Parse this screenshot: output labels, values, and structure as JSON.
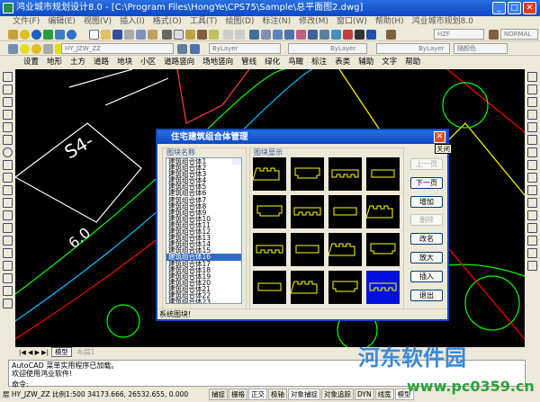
{
  "window": {
    "title": "鸿业城市规划设计8.0 - [C:\\Program Files\\HongYe\\CPS75\\Sample\\总平面图2.dwg]",
    "min": "_",
    "max": "□",
    "close": "✕"
  },
  "menu": [
    "文件(F)",
    "编辑(E)",
    "视图(V)",
    "插入(I)",
    "格式(O)",
    "工具(T)",
    "绘图(D)",
    "标注(N)",
    "修改(M)",
    "窗口(W)",
    "帮助(H)",
    "鸿业城市规划8.0"
  ],
  "toolbar": {
    "layer": "HY_JZW_ZZ",
    "textstyle": "HZF",
    "dimstyle": "NORMAL",
    "color": "ByLayer",
    "linetype": "ByLayer",
    "lineweight": "ByLayer",
    "plotstyle": "随颜色"
  },
  "custom_menu": [
    "设置",
    "地形",
    "土方",
    "道路",
    "地块",
    "小区",
    "道路竖向",
    "场地竖向",
    "管线",
    "绿化",
    "鸟瞰",
    "标注",
    "表类",
    "辅助",
    "文字",
    "帮助"
  ],
  "drawing": {
    "label1": "S4-",
    "label2": "6.0"
  },
  "dialog": {
    "title": "住宅建筑组合体管理",
    "close_tooltip": "关闭",
    "list_label": "图块名称",
    "preview_label": "图块显示",
    "items": [
      "建筑组合体1",
      "建筑组合体2",
      "建筑组合体3",
      "建筑组合体4",
      "建筑组合体5",
      "建筑组合体6",
      "建筑组合体7",
      "建筑组合体8",
      "建筑组合体9",
      "建筑组合体10",
      "建筑组合体11",
      "建筑组合体12",
      "建筑组合体13",
      "建筑组合体14",
      "建筑组合体15",
      "建筑组合体16",
      "建筑组合体17",
      "建筑组合体18",
      "建筑组合体19",
      "建筑组合体20",
      "建筑组合体21",
      "建筑组合体22",
      "建筑组合体23"
    ],
    "selected_item": "建筑组合体16",
    "buttons": {
      "prev": "上一页",
      "next": "下一页",
      "add": "增加",
      "delete": "删除",
      "rename": "改名",
      "zoom": "放大",
      "insert": "插入",
      "exit": "退出"
    },
    "status": "系统图块!"
  },
  "tabs": {
    "model": "模型",
    "layout": "布局1"
  },
  "command": {
    "line1": "AutoCAD 菜单实用程序已加载。",
    "line2": "欢迎使用鸿业软件!",
    "prompt": "命令:"
  },
  "status": {
    "layer": "层 HY_JZW_ZZ",
    "scale": "比例1:500",
    "coords": "34173.666, 26532.655, 0.000",
    "toggles": [
      "捕捉",
      "栅格",
      "正交",
      "极轴",
      "对象捕捉",
      "对象追踪",
      "DYN",
      "线宽",
      "模型"
    ]
  },
  "watermark": {
    "name": "河东软件园",
    "url": "www.pc0359.cn"
  }
}
